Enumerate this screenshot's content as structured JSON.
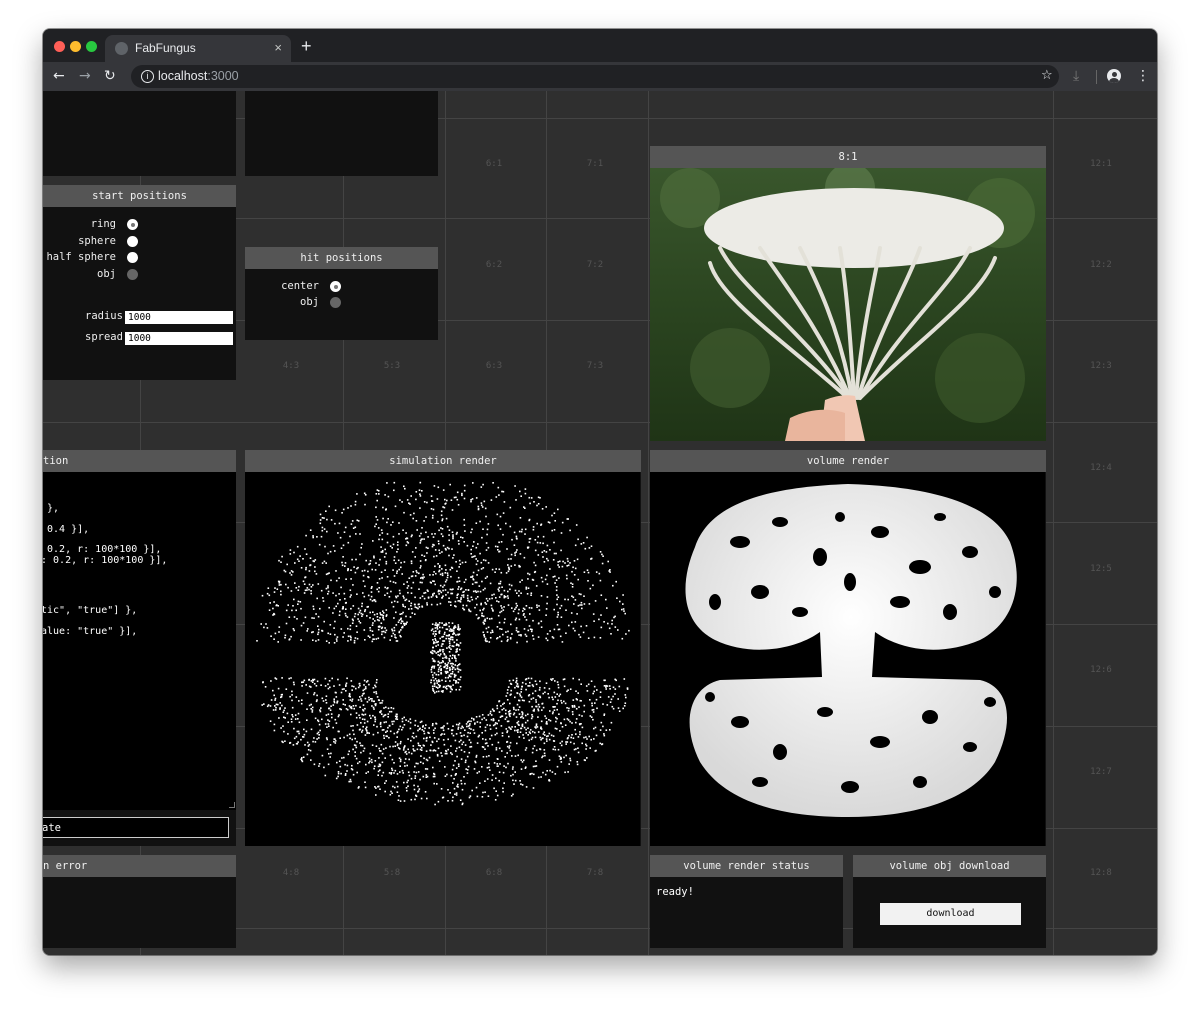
{
  "browser": {
    "traffic_colors": {
      "close": "#ff5f57",
      "minimize": "#febc2e",
      "maximize": "#28c840"
    },
    "tab_title": "FabFungus",
    "tab_close": "×",
    "new_tab": "+",
    "url_host": "localhost",
    "url_port": ":3000",
    "icons": [
      "back-icon",
      "forward-icon",
      "reload-icon",
      "info-icon",
      "star-icon",
      "download-icon",
      "account-icon",
      "menu-icon"
    ]
  },
  "grid_labels": {
    "c6_1": "6:1",
    "c7_1": "7:1",
    "c12_1": "12:1",
    "c6_2": "6:2",
    "c7_2": "7:2",
    "c12_2": "12:2",
    "c4_3": "4:3",
    "c5_3": "5:3",
    "c6_3": "6:3",
    "c7_3": "7:3",
    "c12_3": "12:3",
    "c12_4": "12:4",
    "c12_5": "12:5",
    "c12_6": "12:6",
    "c12_7": "12:7",
    "c4_8": "4:8",
    "c5_8": "5:8",
    "c6_8": "6:8",
    "c7_8": "7:8",
    "c12_8": "12:8"
  },
  "start_positions": {
    "title": "start positions",
    "options": [
      {
        "label": "ring",
        "checked": true
      },
      {
        "label": "sphere",
        "checked": false
      },
      {
        "label": "half sphere",
        "checked": false
      },
      {
        "label": "obj",
        "checked": false,
        "disabled": true
      }
    ],
    "radius_label": "radius",
    "radius_value": "1000",
    "spread_label": "spread",
    "spread_value": "1000"
  },
  "hit_positions": {
    "title": "hit positions",
    "options": [
      {
        "label": "center",
        "checked": true
      },
      {
        "label": "obj",
        "checked": false,
        "disabled": true
      }
    ]
  },
  "photo": {
    "title": "8:1"
  },
  "simulation_config": {
    "title_partial": "tion",
    "code_lines": [
      " },",
      " 0.4 }],",
      " 0.2, r: 100*100 }],",
      ": 0.2, r: 100*100 }],",
      "tic\", \"true\"] },",
      "alue: \"true\" }],"
    ],
    "update_label": "ate"
  },
  "simulation_render": {
    "title": "simulation render"
  },
  "volume_render": {
    "title": "volume render"
  },
  "simulation_error": {
    "title_partial": "n error"
  },
  "volume_render_status": {
    "title": "volume render status",
    "status": "ready!"
  },
  "volume_obj_download": {
    "title": "volume obj download",
    "button": "download"
  }
}
